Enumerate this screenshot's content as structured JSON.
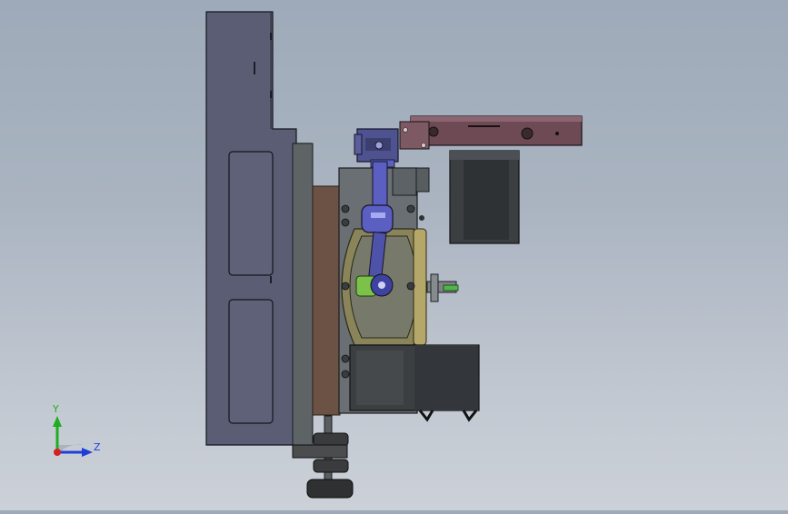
{
  "viewport": {
    "model": "cad-assembly-side-view"
  },
  "triad": {
    "y_label": "Y",
    "z_label": "Z",
    "colors": {
      "y": "#1fae1f",
      "z": "#1f3fd6",
      "x": "#d81f1f"
    }
  },
  "colors": {
    "background_top": "#9eaab9",
    "background_bottom": "#ccd1d8",
    "frame_plate": "#5b5d74",
    "frame_outline": "#1a1a22",
    "wood_plate": "#6b5244",
    "body_grey": "#696f72",
    "motor_dark": "#3c3f42",
    "rail_red": "#6e4a55",
    "link_purple": "#5b5fc2",
    "gear_yellow": "#b5a66a",
    "shaft_green": "#7cc24a",
    "foot_dark": "#3a3b3c"
  }
}
